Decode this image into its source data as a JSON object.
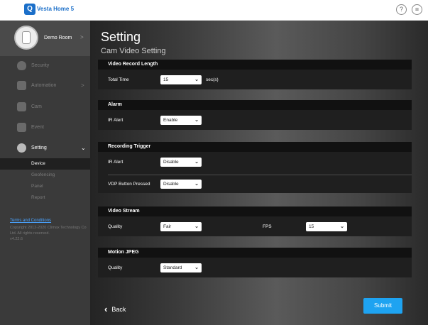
{
  "app": {
    "title": "Vesta Home 5",
    "logo_glyph": "Q"
  },
  "top_icons": {
    "help": "?",
    "menu": "≡"
  },
  "sidebar": {
    "room_name": "Demo Room",
    "room_chevron": ">",
    "items": [
      {
        "label": "Security",
        "icon": "shield-icon"
      },
      {
        "label": "Automation",
        "icon": "automation-icon",
        "chevron": ">"
      },
      {
        "label": "Cam",
        "icon": "camera-icon"
      },
      {
        "label": "Event",
        "icon": "event-icon"
      },
      {
        "label": "Setting",
        "icon": "gear-icon",
        "chevron": "⌄",
        "active": true
      }
    ],
    "sub_items": [
      {
        "label": "Device",
        "active": true
      },
      {
        "label": "Geofencing"
      },
      {
        "label": "Panel"
      },
      {
        "label": "Report"
      }
    ],
    "footer": {
      "terms": "Terms and Conditions",
      "copyright": "Copyright 2012-2020 Climax Technology Co Ltd. All rights reserved.",
      "version": "v4.22.6"
    }
  },
  "main": {
    "title": "Setting",
    "subtitle": "Cam Video Setting",
    "sections": {
      "video_record": {
        "title": "Video Record Length",
        "label": "Total Time",
        "value": "15",
        "unit": "sec(s)"
      },
      "alarm": {
        "title": "Alarm",
        "label": "IR Alert",
        "value": "Enable"
      },
      "recording_trigger": {
        "title": "Recording Trigger",
        "ir_label": "IR Alert",
        "ir_value": "Disable",
        "vdp_label": "VDP Button Pressed",
        "vdp_value": "Disable"
      },
      "video_stream": {
        "title": "Video Stream",
        "quality_label": "Quality",
        "quality_value": "Fair",
        "fps_label": "FPS",
        "fps_value": "15"
      },
      "motion_jpeg": {
        "title": "Motion JPEG",
        "quality_label": "Quality",
        "quality_value": "Standard"
      }
    },
    "back_label": "Back",
    "submit_label": "Submit"
  },
  "colors": {
    "accent": "#1ea3f1",
    "brand": "#1b6fc9",
    "link": "#4aa3ff"
  }
}
